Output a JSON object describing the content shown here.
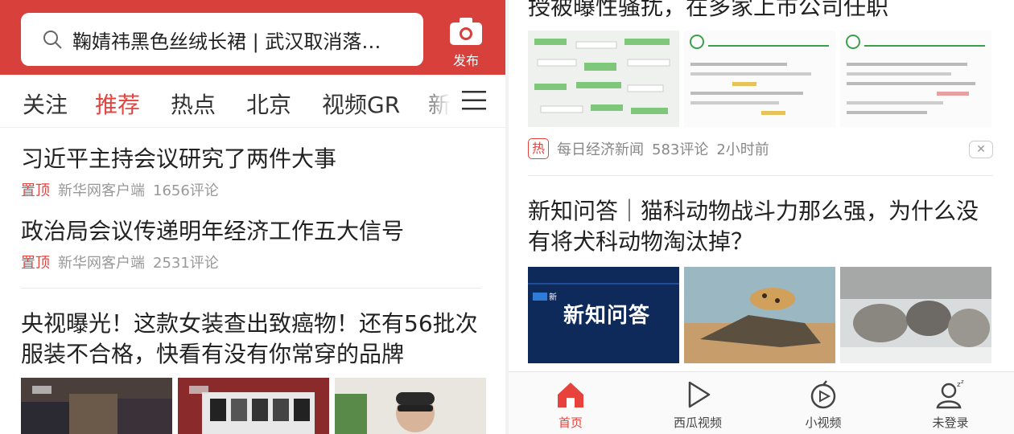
{
  "colors": {
    "accent": "#e8423d",
    "header_bg": "#d8403c"
  },
  "header": {
    "search_text": "鞠婧祎黑色丝绒长裙 | 武汉取消落…",
    "publish_label": "发布"
  },
  "tabs": [
    "关注",
    "推荐",
    "热点",
    "北京",
    "视频GR",
    "新"
  ],
  "active_tab": "推荐",
  "feed_left": [
    {
      "title": "习近平主持会议研究了两件大事",
      "pin": "置顶",
      "source": "新华网客户端",
      "comments": "1656评论"
    },
    {
      "title": "政治局会议传递明年经济工作五大信号",
      "pin": "置顶",
      "source": "新华网客户端",
      "comments": "2531评论"
    },
    {
      "title": "央视曝光！这款女装查出致癌物！还有56批次服装不合格，快看有没有你常穿的品牌"
    }
  ],
  "feed_right": {
    "top_title_partial": "授被曝性骚扰，在多家上市公司任职",
    "top_meta": {
      "badge": "热",
      "source": "每日经济新闻",
      "comments": "583评论",
      "time": "2小时前",
      "dislike": "✕"
    },
    "second_title": "新知问答｜猫科动物战斗力那么强，为什么没有将犬科动物淘汰掉？",
    "video_card_text": "新知问答",
    "video_card_logo": "新"
  },
  "bottom_nav": [
    {
      "label": "首页",
      "icon": "home-icon",
      "active": true
    },
    {
      "label": "西瓜视频",
      "icon": "play-icon",
      "active": false
    },
    {
      "label": "小视频",
      "icon": "short-video-icon",
      "active": false
    },
    {
      "label": "未登录",
      "icon": "user-icon",
      "active": false
    }
  ]
}
